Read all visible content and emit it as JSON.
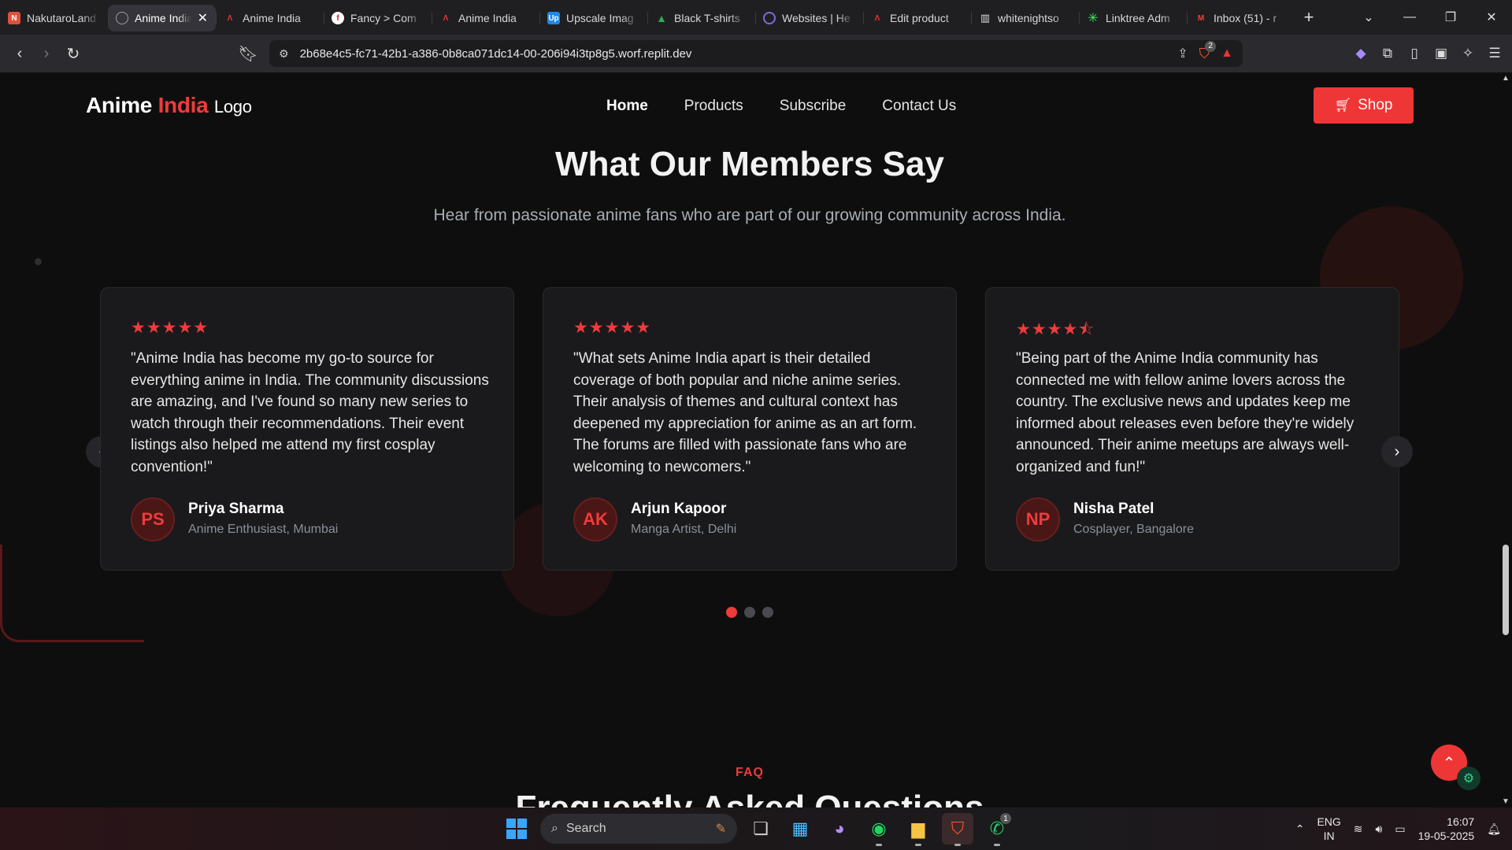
{
  "browser": {
    "tabs": [
      {
        "title": "NakutaroLand",
        "icon": "nakutaro-favicon",
        "color": "#e0503a",
        "active": false
      },
      {
        "title": "Anime India",
        "icon": "globe-icon",
        "color": "#9aa0a6",
        "active": true
      },
      {
        "title": "Anime India",
        "icon": "a-logo-favicon",
        "color": "#d33",
        "active": false
      },
      {
        "title": "Fancy > Com",
        "icon": "fancy-favicon",
        "color": "#c22",
        "active": false
      },
      {
        "title": "Anime India",
        "icon": "a-logo-favicon",
        "color": "#d33",
        "active": false
      },
      {
        "title": "Upscale Imag",
        "icon": "upscale-favicon",
        "color": "#1e88e5",
        "active": false
      },
      {
        "title": "Black T-shirts",
        "icon": "google-drive-favicon",
        "color": "#34a853",
        "active": false
      },
      {
        "title": "Websites | He",
        "icon": "websites-favicon",
        "color": "#7b6cd9",
        "active": false
      },
      {
        "title": "Edit product",
        "icon": "a-logo-favicon",
        "color": "#d33",
        "active": false
      },
      {
        "title": "whitenightso",
        "icon": "store-favicon",
        "color": "#ddd",
        "active": false
      },
      {
        "title": "Linktree Adm",
        "icon": "linktree-favicon",
        "color": "#43e660",
        "active": false
      },
      {
        "title": "Inbox (51) - r",
        "icon": "gmail-favicon",
        "color": "#ea4335",
        "active": false
      }
    ],
    "url": "2b68e4c5-fc71-42b1-a386-0b8ca071dc14-00-206i94i3tp8g5.worf.replit.dev",
    "brave_badge": "2"
  },
  "site": {
    "logo": {
      "part1": "Anime",
      "part2": "India",
      "part3": "Logo"
    },
    "nav": [
      "Home",
      "Products",
      "Subscribe",
      "Contact Us"
    ],
    "active_nav": "Home",
    "shop_label": "Shop",
    "accent": "#ef3b3b"
  },
  "testimonials": {
    "title": "What Our Members Say",
    "subtitle": "Hear from passionate anime fans who are part of our growing community across India.",
    "items": [
      {
        "rating": 5,
        "stars": "★★★★★",
        "quote": "\"Anime India has become my go-to source for everything anime in India. The community discussions are amazing, and I've found so many new series to watch through their recommendations. Their event listings also helped me attend my first cosplay convention!\"",
        "initials": "PS",
        "name": "Priya Sharma",
        "role": "Anime Enthusiast, Mumbai"
      },
      {
        "rating": 5,
        "stars": "★★★★★",
        "quote": "\"What sets Anime India apart is their detailed coverage of both popular and niche anime series. Their analysis of themes and cultural context has deepened my appreciation for anime as an art form. The forums are filled with passionate fans who are welcoming to newcomers.\"",
        "initials": "AK",
        "name": "Arjun Kapoor",
        "role": "Manga Artist, Delhi"
      },
      {
        "rating": 4.5,
        "stars": "★★★★⯪",
        "quote": "\"Being part of the Anime India community has connected me with fellow anime lovers across the country. The exclusive news and updates keep me informed about releases even before they're widely announced. Their anime meetups are always well-organized and fun!\"",
        "initials": "NP",
        "name": "Nisha Patel",
        "role": "Cosplayer, Bangalore"
      }
    ],
    "page_count": 3,
    "current_page": 1
  },
  "faq": {
    "tag": "FAQ",
    "title": "Frequently Asked Questions"
  },
  "taskbar": {
    "search_placeholder": "Search",
    "lang_top": "ENG",
    "lang_bottom": "IN",
    "time": "16:07",
    "date": "19-05-2025",
    "whatsapp_badge": "1"
  }
}
